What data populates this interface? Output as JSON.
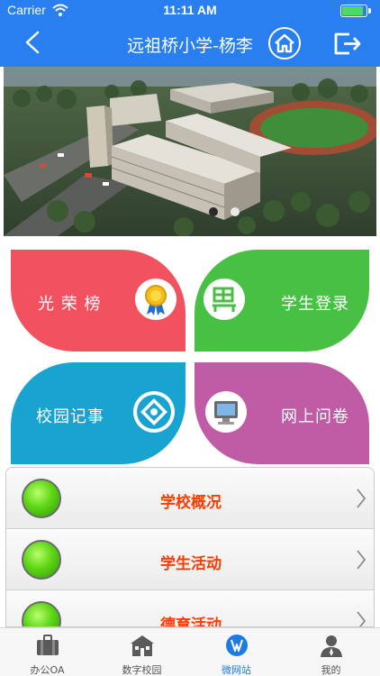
{
  "status_bar": {
    "carrier": "Carrier",
    "time": "11:11 AM",
    "battery_level": 0.9
  },
  "nav": {
    "title": "远祖桥小学-杨李",
    "back_icon": "chevron-left-icon",
    "home_icon": "home-icon",
    "logout_icon": "logout-icon"
  },
  "banner": {
    "image": "aerial-school-campus-render",
    "page_count": 2,
    "active_page": 2
  },
  "tiles": [
    {
      "label": "光 荣 榜",
      "icon": "medal-icon",
      "color": "#f2525f"
    },
    {
      "label": "学生登录",
      "icon": "student-desk-icon",
      "color": "#48c043"
    },
    {
      "label": "校园记事",
      "icon": "campus-note-icon",
      "color": "#18a3d1"
    },
    {
      "label": "网上问卷",
      "icon": "computer-monitor-icon",
      "color": "#c05ba5"
    }
  ],
  "list": [
    {
      "label": "学校概况",
      "icon": "green-ball-icon"
    },
    {
      "label": "学生活动",
      "icon": "green-ball-icon"
    },
    {
      "label": "德育活动",
      "icon": "green-ball-icon"
    }
  ],
  "tabbar": {
    "active_index": 2,
    "accent_color": "#1e7be6",
    "tabs": [
      {
        "label": "办公OA",
        "icon": "briefcase-icon"
      },
      {
        "label": "数字校园",
        "icon": "school-building-icon"
      },
      {
        "label": "微网站",
        "icon": "website-globe-icon"
      },
      {
        "label": "我的",
        "icon": "user-profile-icon"
      }
    ]
  },
  "colors": {
    "header_blue": "#2a7ff0",
    "row_label_orange": "#ff3b00"
  }
}
